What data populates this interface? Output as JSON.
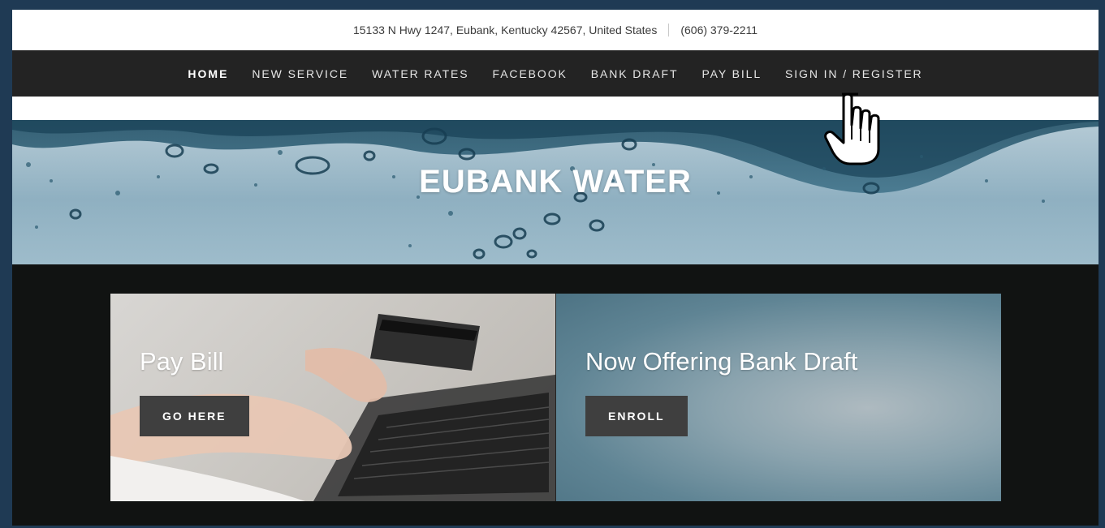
{
  "topbar": {
    "address": "15133 N Hwy 1247, Eubank, Kentucky 42567, United States",
    "phone": "(606) 379-2211"
  },
  "nav": {
    "items": [
      {
        "label": "HOME",
        "active": true
      },
      {
        "label": "NEW SERVICE"
      },
      {
        "label": "WATER RATES"
      },
      {
        "label": "FACEBOOK"
      },
      {
        "label": "BANK DRAFT"
      },
      {
        "label": "PAY BILL"
      },
      {
        "label": "SIGN IN / REGISTER"
      }
    ]
  },
  "hero": {
    "title": "EUBANK WATER"
  },
  "cards": [
    {
      "title": "Pay Bill",
      "button": "GO HERE"
    },
    {
      "title": "Now Offering Bank Draft",
      "button": "ENROLL"
    }
  ],
  "colors": {
    "nav_bg": "#232323",
    "page_bg": "#111312",
    "button_bg": "#3f3f3f",
    "frame": "#1f3a54"
  },
  "icons": {
    "cursor": "hand-pointer-icon"
  }
}
